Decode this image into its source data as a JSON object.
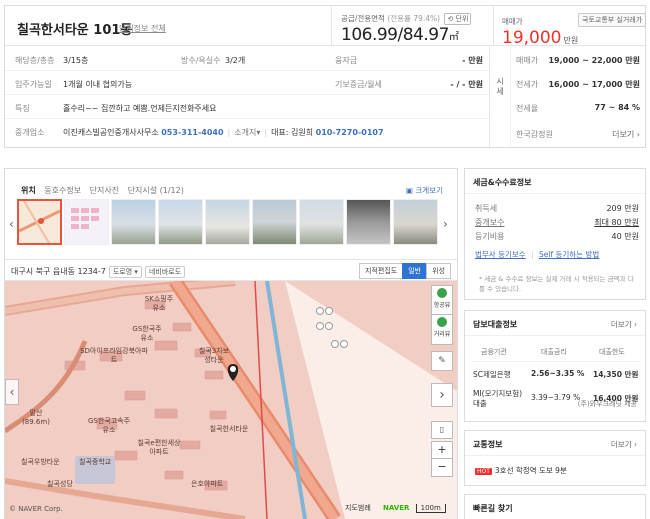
{
  "listing": {
    "title": "칠곡한서타운 101동",
    "complex_link": "단지정보 전체",
    "area_label": "공급/전용면적",
    "area_sub": "(전용률 79.4%)",
    "unit_button": "단위",
    "area_value": "106.99/84.97",
    "area_unit": "㎡",
    "trade_type": "매매가",
    "gov_button": "국토교통부 실거래가",
    "price": "19,000",
    "price_unit": "만원"
  },
  "details": {
    "floor_label": "해당층/총층",
    "floor_value": "3/15층",
    "rooms_label": "방수/욕실수",
    "rooms_value": "3/2개",
    "loan_label": "융자금",
    "loan_value": "- 만원",
    "move_label": "입주가능일",
    "move_value": "1개월 이내 협의가능",
    "deposit_label": "기보증금/월세",
    "deposit_value": "- / - 만원",
    "feature_label": "특징",
    "feature_value": "홀수리~~ 집깐하고 예쁨.언제든지전화주세요",
    "agent_label": "중개업소",
    "agent_name": "이진캐스빌공인중개사사무소",
    "agent_phone": "053-311-4040",
    "agent_intro": "소개지",
    "rep_label": "대표: 김원희",
    "rep_phone": "010-7270-0107"
  },
  "market": {
    "side_label": "시세",
    "sale_label": "매매가",
    "sale_value": "19,000 ~ 22,000 만원",
    "jeonse_label": "전세가",
    "jeonse_value": "16,000 ~ 17,000 만원",
    "ratio_label": "전세율",
    "ratio_value": "77 ~ 84 %",
    "kab_label": "한국감정원",
    "kab_more": "더보기"
  },
  "media": {
    "tabs": [
      "위치",
      "동호수정보",
      "단지사진",
      "단지시설 (1/12)"
    ],
    "big_view": "크게보기",
    "address": "대구시 북구 읍내동 1234-7",
    "road_btn": "도로명",
    "navi_btn": "네비바로도",
    "map_types": [
      "지적편집도",
      "일반",
      "위성"
    ],
    "map_labels": [
      "SK쇼핑주유소",
      "GS한국주유소",
      "SD아이프라임강북아파트",
      "칠곡3차보성타운",
      "칠곡한서타운",
      "GS한국고속주유소",
      "칠곡e편한세상아파트",
      "말산 (89.6m)",
      "칠곡우방타운",
      "칠곡중학교",
      "칠곡성당",
      "은호아파트"
    ],
    "map_controls": [
      "항공뷰",
      "거리뷰"
    ],
    "map_footer_left": "© NAVER Corp.",
    "map_footer_labels": [
      "지도범례",
      "NAVER",
      "100m"
    ]
  },
  "tax": {
    "title": "세금&수수료정보",
    "acq_label": "취득세",
    "acq_value": "209 만원",
    "fee_label": "중개보수",
    "fee_value": "최대 80 만원",
    "reg_label": "등기비용",
    "reg_value": "40 만원",
    "link1": "법무사 등기보수",
    "link2": "Self 등기하는 방법",
    "note": "* 세금 & 수수료 정보는 실제 거래 시 적용되는 금액과 다를 수 있습니다."
  },
  "loan": {
    "title": "담보대출정보",
    "more": "더보기",
    "headers": [
      "금융기관",
      "대출금리",
      "대출한도"
    ],
    "rows": [
      {
        "bank": "SC제일은행",
        "rate": "2.56~3.35 %",
        "limit": "14,350 만원"
      },
      {
        "bank": "MI(모기지보험)대출",
        "rate": "3.39~3.79 %",
        "limit": "16,400 만원"
      }
    ],
    "provider": "(주)와우크레딧 제공"
  },
  "traffic": {
    "title": "교통정보",
    "more": "더보기",
    "badge": "HOT",
    "line": "3호선 학정역 도보 9분"
  },
  "quick": {
    "title": "빠른길 찾기"
  }
}
